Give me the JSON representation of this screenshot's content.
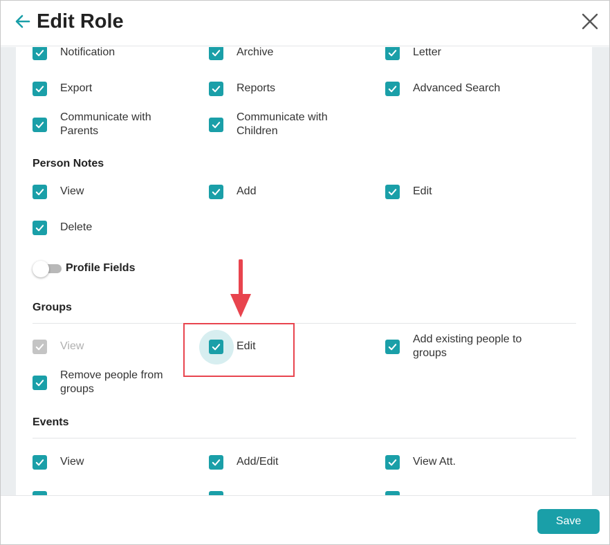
{
  "header": {
    "title": "Edit Role",
    "back_icon": "arrow-left-icon",
    "close_icon": "close-icon"
  },
  "colors": {
    "accent": "#1a9fa8",
    "highlight": "#e8444e",
    "disabled": "#c4c4c4"
  },
  "permissions_top": [
    {
      "label": "Notification",
      "checked": true
    },
    {
      "label": "Archive",
      "checked": true
    },
    {
      "label": "Letter",
      "checked": true
    },
    {
      "label": "Export",
      "checked": true
    },
    {
      "label": "Reports",
      "checked": true
    },
    {
      "label": "Advanced Search",
      "checked": true
    },
    {
      "label": "Communicate with Parents",
      "checked": true
    },
    {
      "label": "Communicate with Children",
      "checked": true
    }
  ],
  "person_notes": {
    "title": "Person Notes",
    "items": [
      {
        "label": "View",
        "checked": true
      },
      {
        "label": "Add",
        "checked": true
      },
      {
        "label": "Edit",
        "checked": true
      },
      {
        "label": "Delete",
        "checked": true
      }
    ]
  },
  "profile_fields": {
    "label": "Profile Fields",
    "enabled": false
  },
  "groups": {
    "title": "Groups",
    "items": [
      {
        "label": "View",
        "checked": true,
        "disabled": true
      },
      {
        "label": "Edit",
        "checked": true,
        "disabled": false
      },
      {
        "label": "Add existing people to groups",
        "checked": true,
        "disabled": false
      },
      {
        "label": "Remove people from groups",
        "checked": true,
        "disabled": false
      }
    ]
  },
  "events": {
    "title": "Events",
    "items": [
      {
        "label": "View",
        "checked": true
      },
      {
        "label": "Add/Edit",
        "checked": true
      },
      {
        "label": "View Att.",
        "checked": true
      }
    ]
  },
  "footer": {
    "save_label": "Save"
  }
}
